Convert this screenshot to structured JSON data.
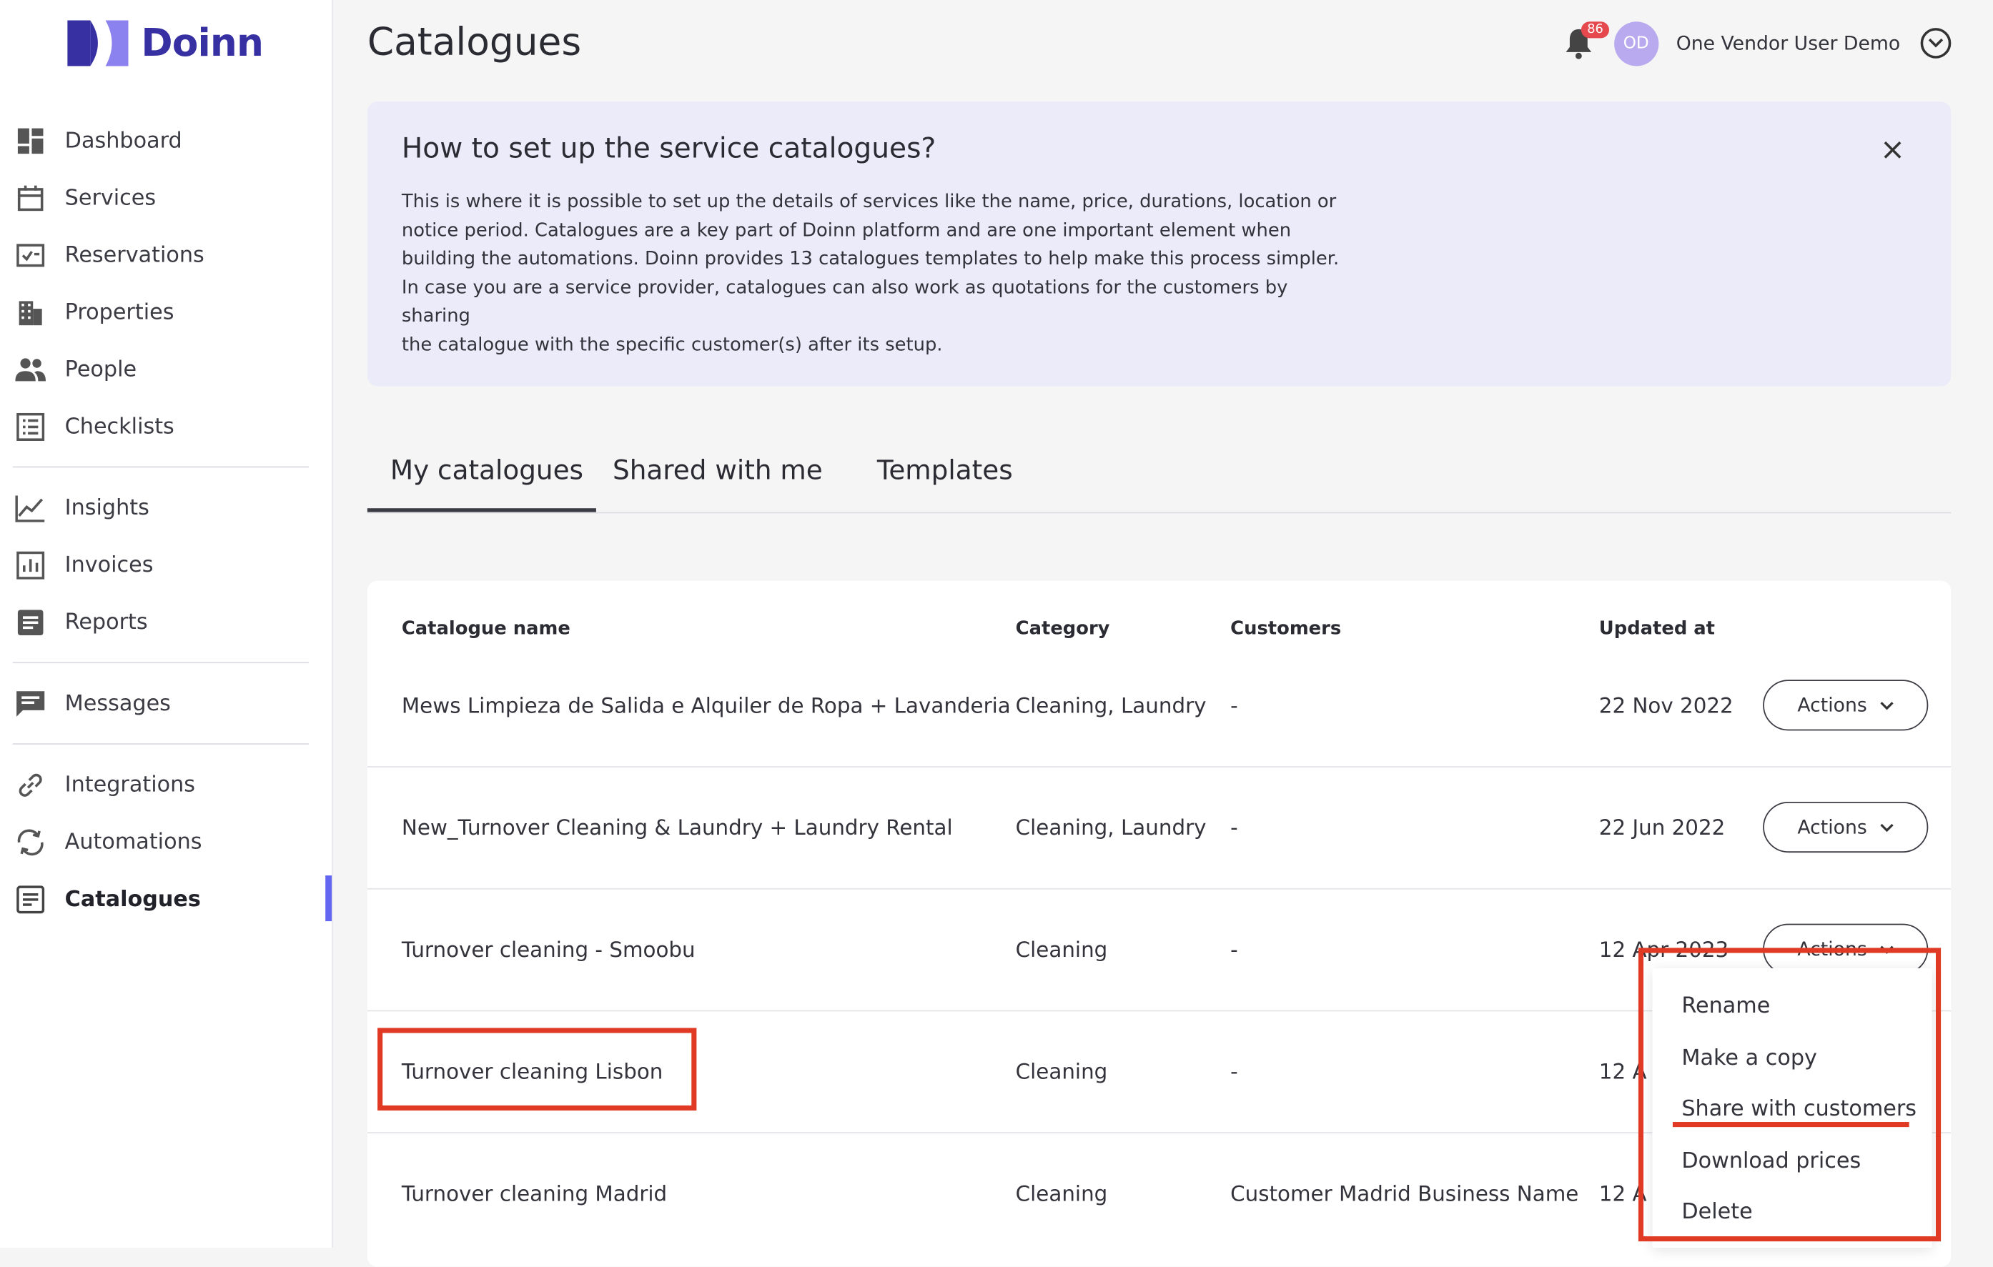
{
  "brand": {
    "name": "Doinn",
    "color": "#3730a3"
  },
  "sidebar": {
    "items": [
      {
        "label": "Dashboard",
        "icon": "dashboard-icon"
      },
      {
        "label": "Services",
        "icon": "calendar-icon"
      },
      {
        "label": "Reservations",
        "icon": "reservations-icon"
      },
      {
        "label": "Properties",
        "icon": "building-icon"
      },
      {
        "label": "People",
        "icon": "people-icon"
      },
      {
        "label": "Checklists",
        "icon": "checklist-icon"
      },
      {
        "label": "Insights",
        "icon": "chart-line-icon"
      },
      {
        "label": "Invoices",
        "icon": "invoice-icon"
      },
      {
        "label": "Reports",
        "icon": "report-icon"
      },
      {
        "label": "Messages",
        "icon": "message-icon"
      },
      {
        "label": "Integrations",
        "icon": "link-icon"
      },
      {
        "label": "Automations",
        "icon": "sync-icon"
      },
      {
        "label": "Catalogues",
        "icon": "catalogue-icon",
        "active": true
      }
    ],
    "active_color": "#6366f1"
  },
  "header": {
    "title": "Catalogues",
    "notification_count": "86",
    "avatar_initials": "OD",
    "user_name": "One Vendor User Demo"
  },
  "info": {
    "title": "How to set up the service catalogues?",
    "body": "This is where it is possible to set up the details of services like the name, price, durations, location or\nnotice period. Catalogues are a key part of Doinn platform and are one important element when\nbuilding the automations. Doinn provides 13 catalogues templates to help make this process simpler.\nIn case you are a service provider, catalogues can also work as quotations for the customers by sharing\nthe catalogue with the specific customer(s) after its setup."
  },
  "tabs": [
    {
      "label": "My catalogues",
      "active": true
    },
    {
      "label": "Shared with me"
    },
    {
      "label": "Templates"
    }
  ],
  "table": {
    "columns": [
      "Catalogue name",
      "Category",
      "Customers",
      "Updated at"
    ],
    "action_label": "Actions",
    "rows": [
      {
        "name": "Mews Limpieza de Salida e Alquiler de Ropa + Lavanderia",
        "category": "Cleaning, Laundry",
        "customers": "-",
        "updated": "22 Nov 2022"
      },
      {
        "name": "New_Turnover Cleaning & Laundry + Laundry Rental",
        "category": "Cleaning, Laundry",
        "customers": "-",
        "updated": "22 Jun 2022"
      },
      {
        "name": "Turnover cleaning - Smoobu",
        "category": "Cleaning",
        "customers": "-",
        "updated": "12 Apr 2023"
      },
      {
        "name": "Turnover cleaning Lisbon",
        "category": "Cleaning",
        "customers": "-",
        "updated": "12 A"
      },
      {
        "name": "Turnover cleaning Madrid",
        "category": "Cleaning",
        "customers": "Customer Madrid Business Name",
        "updated": "12 A"
      }
    ]
  },
  "dropdown": {
    "items": [
      "Rename",
      "Make a copy",
      "Share with customers",
      "Download prices",
      "Delete"
    ]
  },
  "annotation_color": "#e03a25"
}
